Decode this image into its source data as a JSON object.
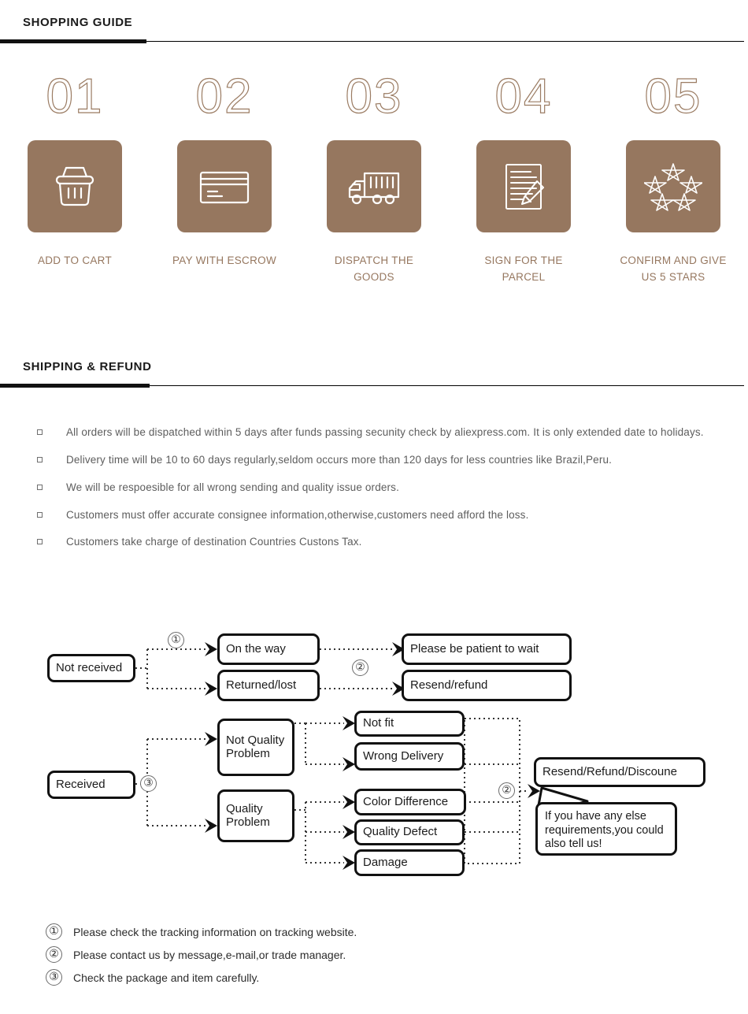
{
  "sections": {
    "guide": {
      "title": "SHOPPING GUIDE"
    },
    "shipping": {
      "title": "SHIPPING & REFUND"
    }
  },
  "colors": {
    "brand_brown": "#96775f",
    "number_outline": "#9b7c63",
    "rule_black": "#111111",
    "body_text": "#5d5d5d"
  },
  "steps": [
    {
      "number": "01",
      "icon": "shopping-basket-icon",
      "label": "ADD TO CART"
    },
    {
      "number": "02",
      "icon": "credit-card-icon",
      "label": "PAY WITH ESCROW"
    },
    {
      "number": "03",
      "icon": "delivery-truck-icon",
      "label": "DISPATCH THE GOODS"
    },
    {
      "number": "04",
      "icon": "document-pencil-icon",
      "label": "SIGN FOR THE PARCEL"
    },
    {
      "number": "05",
      "icon": "five-stars-icon",
      "label": "CONFIRM AND GIVE US 5 STARS"
    }
  ],
  "policy_bullets": [
    "All orders will be dispatched within 5 days after funds passing secunity check by aliexpress.com. It is only extended date to holidays.",
    "Delivery time will be 10 to 60 days regularly,seldom occurs more than 120 days for less countries like Brazil,Peru.",
    "We will be respoesible for all wrong sending and quality issue orders.",
    "Customers must offer accurate consignee information,otherwise,customers need afford the loss.",
    "Customers take charge of destination Countries Custons Tax."
  ],
  "flow": {
    "not_received": "Not received",
    "on_the_way": "On the way",
    "returned_lost": "Returned/lost",
    "please_wait": "Please be patient to wait",
    "resend_refund": "Resend/refund",
    "received": "Received",
    "not_quality_problem": "Not Quality Problem",
    "quality_problem": "Quality Problem",
    "not_fit": "Not fit",
    "wrong_delivery": "Wrong Delivery",
    "color_difference": "Color Difference",
    "quality_defect": "Quality Defect",
    "damage": "Damage",
    "resend_refund_discount": "Resend/Refund/Discoune",
    "extra_note": "If you have any else requirements,you could also tell us!",
    "marker_1": "①",
    "marker_2": "②",
    "marker_2b": "②",
    "marker_2c": "②",
    "marker_3": "③"
  },
  "notes": [
    {
      "num": "①",
      "text": "Please check the tracking information on tracking website."
    },
    {
      "num": "②",
      "text": "Please contact us by message,e-mail,or trade manager."
    },
    {
      "num": "③",
      "text": "Check the package and item carefully."
    }
  ]
}
